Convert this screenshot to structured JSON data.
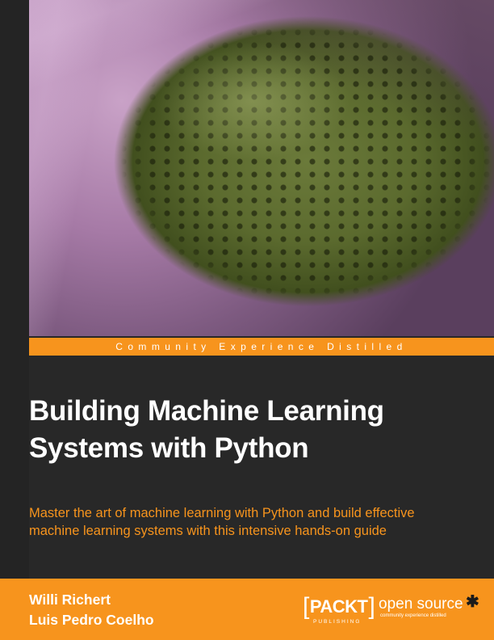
{
  "tagline": "Community Experience Distilled",
  "title_lines": [
    "Building Machine Learning",
    "Systems with Python"
  ],
  "subtitle_lines": [
    "Master the art of machine learning with Python and build effective",
    "machine learning systems with this intensive hands-on guide"
  ],
  "authors": [
    "Willi Richert",
    "Luis Pedro Coelho"
  ],
  "publisher": {
    "packt": "PACKT",
    "publishing": "PUBLISHING",
    "open_source": "open source",
    "open_source_tag": "community experience distilled"
  },
  "colors": {
    "accent_orange": "#f7941d",
    "background": "#282828",
    "text_white": "#ffffff"
  },
  "icons": {
    "star": "asterisk-star-icon"
  }
}
